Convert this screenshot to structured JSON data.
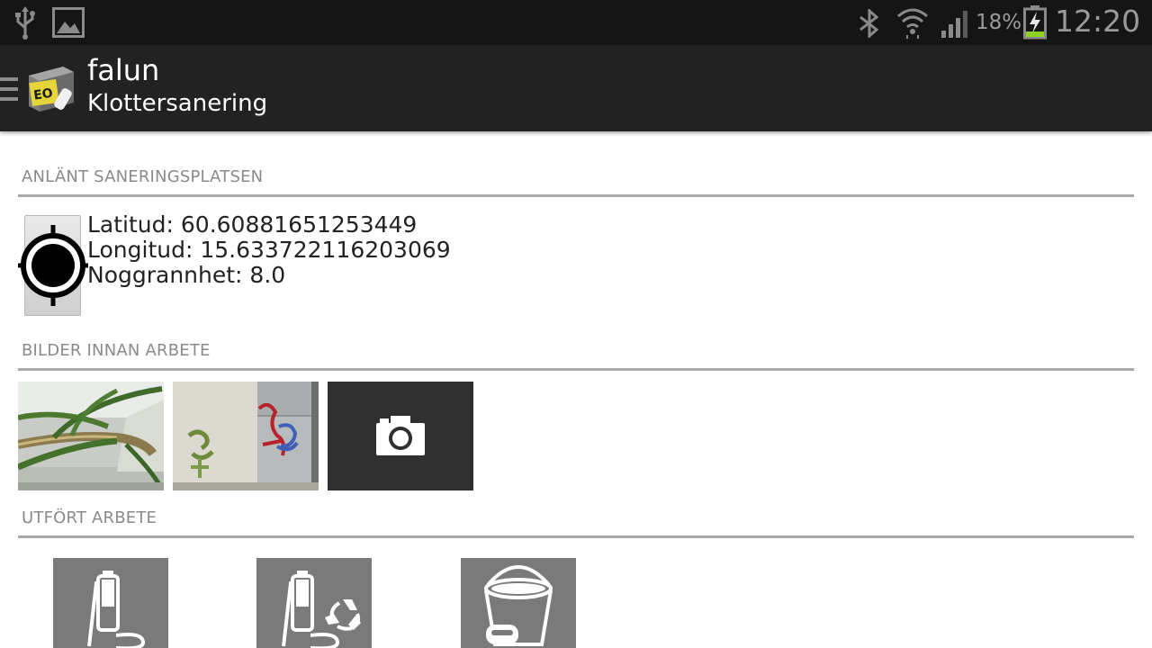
{
  "status_bar": {
    "icons": [
      "usb-icon",
      "gallery-notification-icon",
      "bluetooth-icon",
      "wifi-icon",
      "signal-icon",
      "battery-charging-icon"
    ],
    "battery_percent": "18%",
    "clock": "12:20"
  },
  "action_bar": {
    "title": "falun",
    "subtitle": "Klottersanering",
    "icons": [
      "drawer-menu-icon",
      "app-logo-icon"
    ]
  },
  "sections": {
    "arrived": {
      "header": "ANLÄNT SANERINGSPLATSEN",
      "latitude": "Latitud: 60.60881651253449",
      "longitude": "Longitud: 15.633722116203069",
      "accuracy": "Noggrannhet: 8.0",
      "icon": "gps-target-icon"
    },
    "before_images": {
      "header": "BILDER INNAN ARBETE",
      "icons": [
        "photo-thumbnail-plant",
        "photo-thumbnail-graffiti",
        "camera-icon"
      ]
    },
    "work_done": {
      "header": "UTFÖRT ARBETE",
      "icons": [
        "pressure-washer-icon",
        "pressure-washer-recycle-icon",
        "bucket-sponge-icon"
      ]
    }
  },
  "colors": {
    "status_bar_bg": "#151515",
    "action_bar_bg": "#222222",
    "section_header": "#8a8a8a",
    "rule": "#a9a9a9",
    "tile_bg": "#7a7a7a",
    "camera_tile_bg": "#2f2f2f",
    "battery_green": "#8cd21e"
  }
}
